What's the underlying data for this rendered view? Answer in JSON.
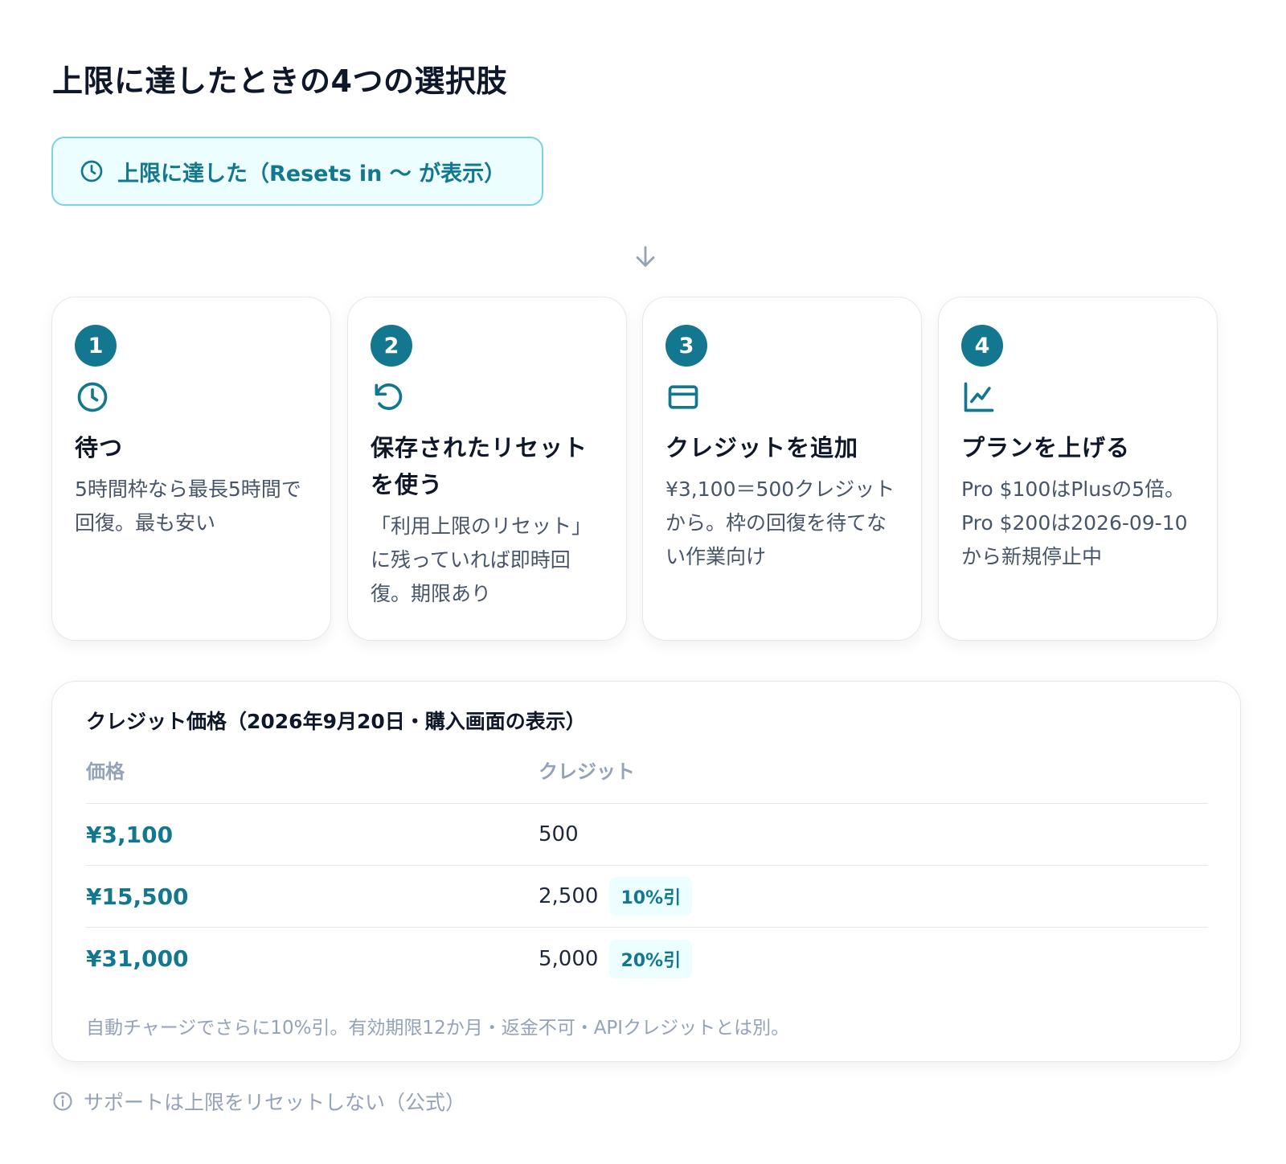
{
  "page": {
    "title": "上限に達したときの4つの選択肢"
  },
  "banner": {
    "icon": "clock-icon",
    "label": "上限に達した（Resets in 〜 が表示）"
  },
  "flow_arrow": "arrow-down-icon",
  "options": [
    {
      "number": "1",
      "icon": "clock-icon",
      "title": "待つ",
      "description": "5時間枠なら最長5時間で回復。最も安い"
    },
    {
      "number": "2",
      "icon": "reset-icon",
      "title": "保存されたリセットを使う",
      "description": "「利用上限のリセット」に残っていれば即時回復。期限あり"
    },
    {
      "number": "3",
      "icon": "credit-card-icon",
      "title": "クレジットを追加",
      "description": "¥3,100＝500クレジットから。枠の回復を待てない作業向け"
    },
    {
      "number": "4",
      "icon": "chart-line-icon",
      "title": "プランを上げる",
      "description": "Pro $100はPlusの5倍。Pro $200は2026-09-10から新規停止中"
    }
  ],
  "pricing": {
    "title": "クレジット価格（2026年9月20日・購入画面の表示）",
    "headers": {
      "price": "価格",
      "credits": "クレジット"
    },
    "rows": [
      {
        "price": "¥3,100",
        "credits": "500",
        "badge": ""
      },
      {
        "price": "¥15,500",
        "credits": "2,500",
        "badge": "10%引"
      },
      {
        "price": "¥31,000",
        "credits": "5,000",
        "badge": "20%引"
      }
    ],
    "note": "自動チャージでさらに10%引。有効期限12か月・返金不可・APIクレジットとは別。"
  },
  "footer": {
    "icon": "info-icon",
    "text": "サポートは上限をリセットしない（公式）"
  },
  "colors": {
    "accent": "#13788f",
    "banner_bg": "#ecfeff",
    "banner_border": "#7dd3e1",
    "muted": "#94a3b8"
  }
}
